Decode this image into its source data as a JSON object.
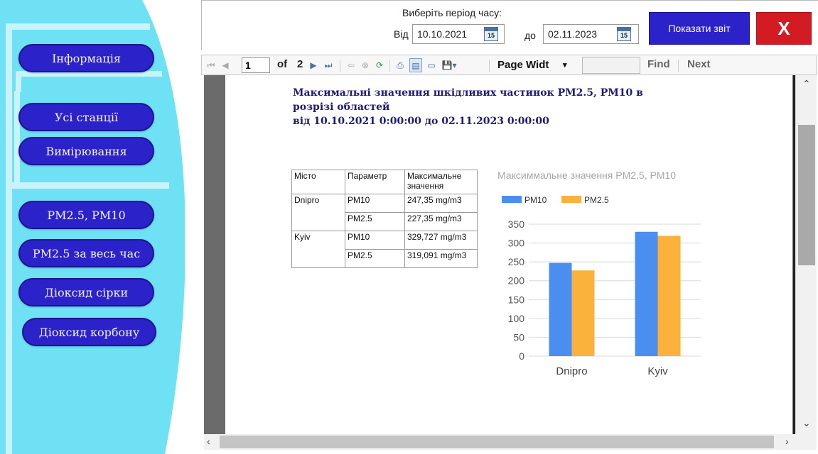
{
  "sidebar": {
    "items": [
      {
        "label": "Інформація"
      },
      {
        "label": "Усі станції"
      },
      {
        "label": "Вимірювання"
      },
      {
        "label": "PM2.5, PM10"
      },
      {
        "label": "PM2.5 за весь час"
      },
      {
        "label": "Діоксид сірки"
      },
      {
        "label": "Діоксид корбону"
      }
    ]
  },
  "period": {
    "title": "Виберіть період часу:",
    "from_label": "Від",
    "from_value": "10.10.2021",
    "to_label": "до",
    "to_value": "02.11.2023",
    "calendar_day": "15",
    "show_button": "Показати звіт",
    "close_button": "X"
  },
  "toolbar": {
    "page": "1",
    "of_label": "of",
    "total_pages": "2",
    "zoom": "Page Widt",
    "find": "Find",
    "next": "Next"
  },
  "report": {
    "title_line1": "Максимальні значення шкідливих частинок PM2.5, PM10 в",
    "title_line2": "розрізі областей",
    "title_line3": "від 10.10.2021 0:00:00  до 02.11.2023 0:00:00",
    "table": {
      "headers": [
        "Місто",
        "Параметр",
        "Максимальне значення"
      ],
      "rows": [
        {
          "city": "Dnipro",
          "param": "PM10",
          "value": "247,35 mg/m3"
        },
        {
          "city": "",
          "param": "PM2.5",
          "value": "227,35 mg/m3"
        },
        {
          "city": "Kyiv",
          "param": "PM10",
          "value": "329,727 mg/m3"
        },
        {
          "city": "",
          "param": "PM2.5",
          "value": "319,091 mg/m3"
        }
      ]
    }
  },
  "colors": {
    "sidebar_bg": "#6fe1f5",
    "button_blue": "#2b22c9",
    "close_red": "#d21b23",
    "series_pm10": "#4a8ef0",
    "series_pm25": "#fbb23c"
  },
  "chart_data": {
    "type": "bar",
    "title": "Максиммальне значення PM2.5, PM10",
    "categories": [
      "Dnipro",
      "Kyiv"
    ],
    "series": [
      {
        "name": "PM10",
        "values": [
          247.35,
          329.727
        ]
      },
      {
        "name": "PM2.5",
        "values": [
          227.35,
          319.091
        ]
      }
    ],
    "yticks": [
      "0",
      "50",
      "100",
      "150",
      "200",
      "250",
      "300",
      "350"
    ],
    "ylim": [
      0,
      350
    ],
    "grid": true,
    "legend": "top-left"
  }
}
